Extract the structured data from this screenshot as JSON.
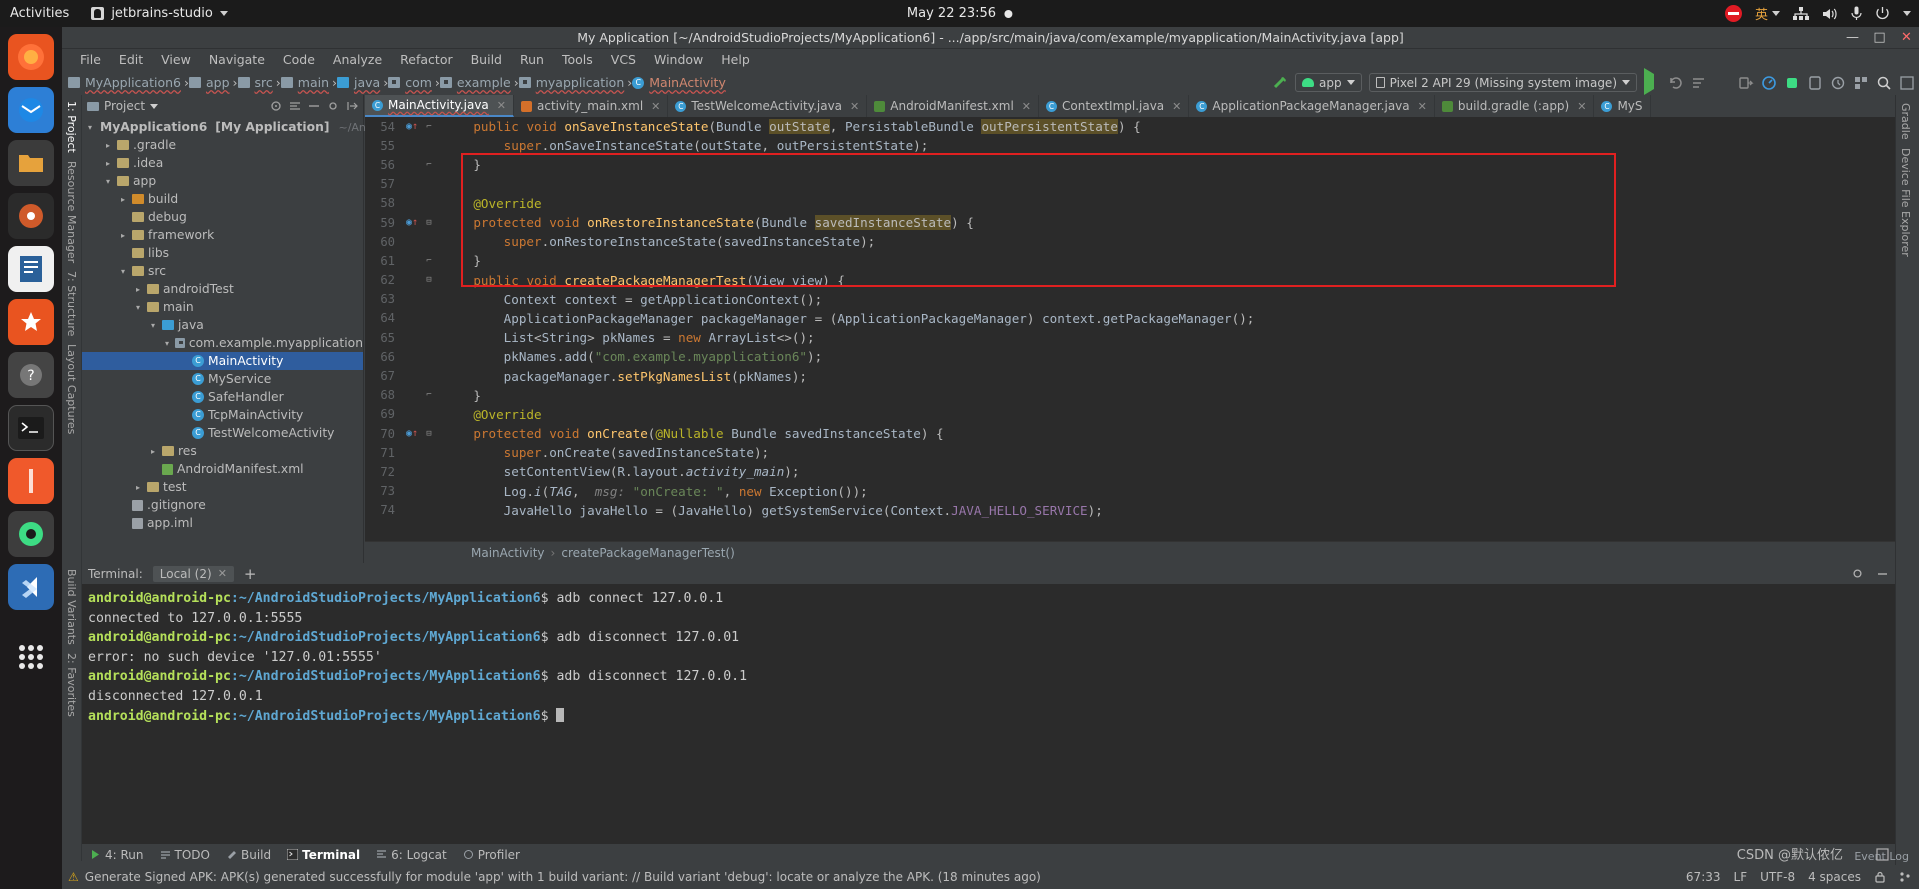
{
  "gnome": {
    "activities": "Activities",
    "app_menu": "jetbrains-studio",
    "clock": "May 22  23:56",
    "ime": "英"
  },
  "window": {
    "title": "My Application [~/AndroidStudioProjects/MyApplication6] - .../app/src/main/java/com/example/myapplication/MainActivity.java [app]",
    "minimize": "—",
    "maximize": "□",
    "close": "✕"
  },
  "menubar": [
    "File",
    "Edit",
    "View",
    "Navigate",
    "Code",
    "Analyze",
    "Refactor",
    "Build",
    "Run",
    "Tools",
    "VCS",
    "Window",
    "Help"
  ],
  "breadcrumb": [
    {
      "label": "MyApplication6",
      "icon": "folder-icon"
    },
    {
      "label": "app",
      "icon": "folder-icon"
    },
    {
      "label": "src",
      "icon": "folder-icon"
    },
    {
      "label": "main",
      "icon": "folder-icon"
    },
    {
      "label": "java",
      "icon": "folder-blue-icon"
    },
    {
      "label": "com",
      "icon": "package-icon"
    },
    {
      "label": "example",
      "icon": "package-icon"
    },
    {
      "label": "myapplication",
      "icon": "package-icon"
    },
    {
      "label": "MainActivity",
      "icon": "class-icon"
    }
  ],
  "toolbar": {
    "run_config": "app",
    "device": "Pixel 2 API 29 (Missing system image)"
  },
  "project_panel": {
    "title": "Project",
    "tree": [
      {
        "label": "MyApplication6",
        "suffix": "[My Application]",
        "path": "~/Andr",
        "depth": 0,
        "arrow": "▾",
        "icon": "project-icon"
      },
      {
        "label": ".gradle",
        "depth": 1,
        "arrow": "▸",
        "icon": "folder-icon"
      },
      {
        "label": ".idea",
        "depth": 1,
        "arrow": "▸",
        "icon": "folder-icon"
      },
      {
        "label": "app",
        "depth": 1,
        "arrow": "▾",
        "icon": "folder-icon"
      },
      {
        "label": "build",
        "depth": 2,
        "arrow": "▸",
        "icon": "folder-orange-icon"
      },
      {
        "label": "debug",
        "depth": 2,
        "arrow": "",
        "icon": "folder-icon"
      },
      {
        "label": "framework",
        "depth": 2,
        "arrow": "▸",
        "icon": "folder-icon"
      },
      {
        "label": "libs",
        "depth": 2,
        "arrow": "",
        "icon": "folder-icon"
      },
      {
        "label": "src",
        "depth": 2,
        "arrow": "▾",
        "icon": "folder-icon"
      },
      {
        "label": "androidTest",
        "depth": 3,
        "arrow": "▸",
        "icon": "folder-icon"
      },
      {
        "label": "main",
        "depth": 3,
        "arrow": "▾",
        "icon": "folder-icon"
      },
      {
        "label": "java",
        "depth": 4,
        "arrow": "▾",
        "icon": "folder-blue-icon"
      },
      {
        "label": "com.example.myapplication",
        "depth": 5,
        "arrow": "▾",
        "icon": "package-icon"
      },
      {
        "label": "MainActivity",
        "depth": 6,
        "arrow": "",
        "icon": "class-icon",
        "selected": true
      },
      {
        "label": "MyService",
        "depth": 6,
        "arrow": "",
        "icon": "class-icon"
      },
      {
        "label": "SafeHandler",
        "depth": 6,
        "arrow": "",
        "icon": "class-icon"
      },
      {
        "label": "TcpMainActivity",
        "depth": 6,
        "arrow": "",
        "icon": "class-icon"
      },
      {
        "label": "TestWelcomeActivity",
        "depth": 6,
        "arrow": "",
        "icon": "class-icon"
      },
      {
        "label": "res",
        "depth": 4,
        "arrow": "▸",
        "icon": "folder-res-icon"
      },
      {
        "label": "AndroidManifest.xml",
        "depth": 4,
        "arrow": "",
        "icon": "manifest-icon"
      },
      {
        "label": "test",
        "depth": 3,
        "arrow": "▸",
        "icon": "folder-icon"
      },
      {
        "label": ".gitignore",
        "depth": 2,
        "arrow": "",
        "icon": "git-icon"
      },
      {
        "label": "app.iml",
        "depth": 2,
        "arrow": "",
        "icon": "iml-icon"
      }
    ]
  },
  "left_stripes": [
    "1: Project",
    "Resource Manager",
    "7: Structure",
    "Layout Captures"
  ],
  "left_bottom_stripes": [
    "Build Variants",
    "2: Favorites"
  ],
  "right_stripes": [
    "Gradle",
    "Device File Explorer"
  ],
  "editor_tabs": [
    {
      "label": "MainActivity.java",
      "icon": "java-class-icon",
      "active": true
    },
    {
      "label": "activity_main.xml",
      "icon": "xml-layout-icon",
      "active": false
    },
    {
      "label": "TestWelcomeActivity.java",
      "icon": "java-class-icon",
      "active": false
    },
    {
      "label": "AndroidManifest.xml",
      "icon": "manifest-icon",
      "active": false
    },
    {
      "label": "ContextImpl.java",
      "icon": "java-class-icon",
      "active": false
    },
    {
      "label": "ApplicationPackageManager.java",
      "icon": "java-class-icon",
      "active": false
    },
    {
      "label": "build.gradle (:app)",
      "icon": "gradle-icon",
      "active": false
    },
    {
      "label": "MyS",
      "icon": "java-class-icon",
      "active": false
    }
  ],
  "code": {
    "first_line": 54,
    "lines": [
      {
        "n": 54,
        "marker": "override",
        "fold": "end",
        "html": "    <span class=\"kw\">public</span> <span class=\"kw\">void</span> <span class=\"fn\">onSaveInstanceState</span>(<span class=\"ty\">Bundle</span> <span class=\"hl\">outState</span>, <span class=\"ty\">PersistableBundle</span> <span class=\"hl\">outPersistentState</span>) {"
      },
      {
        "n": 55,
        "marker": "",
        "fold": "",
        "html": "        <span class=\"kw\">super</span>.<span class=\"id\">onSaveInstanceState</span>(<span class=\"id\">outState</span>, <span class=\"id\">outPersistentState</span>);"
      },
      {
        "n": 56,
        "marker": "",
        "fold": "end",
        "html": "    }"
      },
      {
        "n": 57,
        "marker": "",
        "fold": "",
        "html": ""
      },
      {
        "n": 58,
        "marker": "",
        "fold": "",
        "html": "    <span class=\"an\">@Override</span>"
      },
      {
        "n": 59,
        "marker": "override",
        "fold": "start",
        "html": "    <span class=\"kw\">protected</span> <span class=\"kw\">void</span> <span class=\"fn\">onRestoreInstanceState</span>(<span class=\"ty\">Bundle</span> <span class=\"hl\">savedInstanceState</span>) {"
      },
      {
        "n": 60,
        "marker": "",
        "fold": "",
        "html": "        <span class=\"kw\">super</span>.<span class=\"id\">onRestoreInstanceState</span>(<span class=\"id\">savedInstanceState</span>);"
      },
      {
        "n": 61,
        "marker": "",
        "fold": "end",
        "html": "    }"
      },
      {
        "n": 62,
        "marker": "",
        "fold": "start",
        "html": "    <span class=\"kw\">public</span> <span class=\"kw\">void</span> <span class=\"fn\">createPackageManagerTest</span>(<span class=\"ty\">View</span> <span class=\"id\">view</span>) {"
      },
      {
        "n": 63,
        "marker": "",
        "fold": "",
        "html": "        <span class=\"ty\">Context</span> <span class=\"id\">context</span> = <span class=\"id\">getApplicationContext</span>();"
      },
      {
        "n": 64,
        "marker": "",
        "fold": "",
        "html": "        <span class=\"ty\">ApplicationPackageManager</span> <span class=\"id\">packageManager</span> = (<span class=\"ty\">ApplicationPackageManager</span>) <span class=\"id\">context</span>.<span class=\"id\">getPackageManager</span>();"
      },
      {
        "n": 65,
        "marker": "",
        "fold": "",
        "html": "        <span class=\"ty\">List</span>&lt;<span class=\"ty\">String</span>&gt; <span class=\"id\">pkNames</span> = <span class=\"kw\">new</span> <span class=\"ty\">ArrayList</span>&lt;&gt;();"
      },
      {
        "n": 66,
        "marker": "",
        "fold": "",
        "html": "        <span class=\"id\">pkNames</span>.<span class=\"id\">add</span>(<span class=\"st\">\"com.example.myapplication6\"</span>);"
      },
      {
        "n": 67,
        "marker": "",
        "fold": "",
        "html": "        <span class=\"id\">packageManager</span>.<span class=\"fn\">setPkgNamesList</span>(<span class=\"id\">pkNames</span>);"
      },
      {
        "n": 68,
        "marker": "",
        "fold": "end",
        "html": "    }"
      },
      {
        "n": 69,
        "marker": "",
        "fold": "",
        "html": "    <span class=\"an\">@Override</span>"
      },
      {
        "n": 70,
        "marker": "override",
        "fold": "start",
        "html": "    <span class=\"kw\">protected</span> <span class=\"kw\">void</span> <span class=\"fn\">onCreate</span>(<span class=\"an\">@Nullable</span> <span class=\"ty\">Bundle</span> <span class=\"id\">savedInstanceState</span>) {"
      },
      {
        "n": 71,
        "marker": "",
        "fold": "",
        "html": "        <span class=\"kw\">super</span>.<span class=\"id\">onCreate</span>(<span class=\"id\">savedInstanceState</span>);"
      },
      {
        "n": 72,
        "marker": "",
        "fold": "",
        "html": "        <span class=\"id\">setContentView</span>(<span class=\"ty\">R</span>.<span class=\"id\">layout</span>.<span class=\"ital\">activity_main</span>);"
      },
      {
        "n": 73,
        "marker": "",
        "fold": "",
        "html": "        <span class=\"ty\">Log</span>.<span class=\"ital\">i</span>(<span class=\"ital\">TAG</span>,  <span class=\"mg\">msg:</span> <span class=\"st\">\"onCreate: \"</span>, <span class=\"kw\">new</span> <span class=\"ty\">Exception</span>());"
      },
      {
        "n": 74,
        "marker": "",
        "fold": "",
        "html": "        <span class=\"ty\">JavaHello</span> <span class=\"id\">javaHello</span> = (<span class=\"ty\">JavaHello</span>) <span class=\"id\">getSystemService</span>(<span class=\"ty\">Context</span>.<span class=\"cnst\">JAVA_HELLO_SERVICE</span>);"
      }
    ]
  },
  "editor_breadcrumb": [
    "MainActivity",
    "createPackageManagerTest()"
  ],
  "terminal": {
    "title": "Terminal:",
    "tab": "Local (2)",
    "add": "+",
    "lines": [
      {
        "user": "android@android-pc",
        "path": ":~/AndroidStudioProjects/MyApplication6",
        "prompt": "$ ",
        "cmd": "adb connect 127.0.0.1"
      },
      {
        "plain": "connected to 127.0.0.1:5555"
      },
      {
        "user": "android@android-pc",
        "path": ":~/AndroidStudioProjects/MyApplication6",
        "prompt": "$ ",
        "cmd": "adb disconnect 127.0.01"
      },
      {
        "plain": "error: no such device '127.0.01:5555'"
      },
      {
        "user": "android@android-pc",
        "path": ":~/AndroidStudioProjects/MyApplication6",
        "prompt": "$ ",
        "cmd": "adb disconnect 127.0.0.1"
      },
      {
        "plain": "disconnected 127.0.0.1"
      },
      {
        "user": "android@android-pc",
        "path": ":~/AndroidStudioProjects/MyApplication6",
        "prompt": "$ ",
        "cmd": "",
        "cursor": true
      }
    ]
  },
  "bottom_tabs": [
    {
      "label": "4: Run",
      "icon": "run-icon",
      "selected": false
    },
    {
      "label": "TODO",
      "icon": "todo-icon",
      "selected": false
    },
    {
      "label": "Build",
      "icon": "build-icon",
      "selected": false
    },
    {
      "label": "Terminal",
      "icon": "terminal-icon",
      "selected": true
    },
    {
      "label": "6: Logcat",
      "icon": "logcat-icon",
      "selected": false
    },
    {
      "label": "Profiler",
      "icon": "profiler-icon",
      "selected": false
    }
  ],
  "status": {
    "message": "Generate Signed APK: APK(s) generated successfully for module 'app' with 1 build variant: // Build variant 'debug': locate or analyze the APK. (18 minutes ago)",
    "caret": "67:33",
    "line_sep": "LF",
    "encoding": "UTF-8",
    "indent": "4 spaces",
    "event_log": "Event Log"
  },
  "watermark": "CSDN @默认侬亿",
  "colors": {
    "accent_blue": "#4a88c7",
    "selection": "#2f5d9e",
    "red_box": "#e02020",
    "terminal_green": "#b5e05a",
    "terminal_blue": "#5fa8d3",
    "android_green": "#3ddc84"
  }
}
